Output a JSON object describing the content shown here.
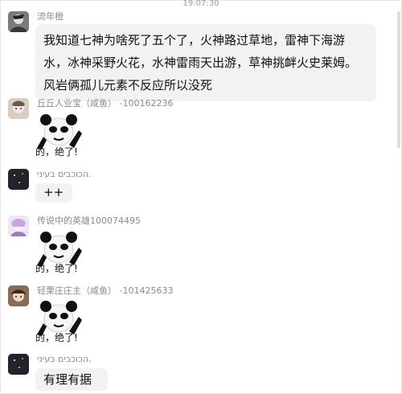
{
  "header": {
    "timestamp": "19:07:30"
  },
  "messages": [
    {
      "sender": "流年橙",
      "text": "我知道七神为啥死了五个了，火神路过草地，雷神下海游水，冰神采野火花，水神雷雨天出游，草神挑衅火史莱姆。风岩俩孤儿元素不反应所以没死"
    },
    {
      "sender": "丘丘人业宝（咸鱼） -100162236",
      "caption": "的，绝了!"
    },
    {
      "sender": "הכוכבים בעיני.",
      "text": "++"
    },
    {
      "sender": "传说中的英雄100074495",
      "caption": "的，绝了!"
    },
    {
      "sender": "轻栗庄庄主（咸鱼） -101425633",
      "caption": "的，绝了!"
    },
    {
      "sender": "הכוכבים בעיני.",
      "text": "有理有据"
    }
  ],
  "icons": {
    "sticker": "panda-meme-sticker",
    "avatar": "user-avatar"
  },
  "colors": {
    "bubble": "#f2f2f2",
    "name": "#8a8a8a",
    "timestamp": "#9a9a9a"
  }
}
